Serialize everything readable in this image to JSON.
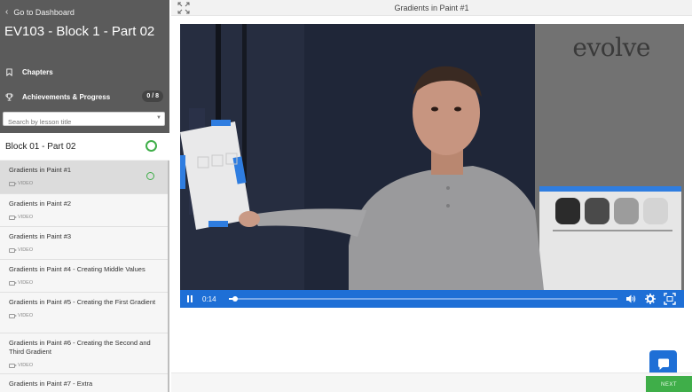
{
  "sidebar": {
    "back_label": "Go to Dashboard",
    "course_title": "EV103 - Block 1 - Part 02",
    "chapters_label": "Chapters",
    "achievements_label": "Achievements & Progress",
    "achievements_count": "0 / 8",
    "search_placeholder": "Search by lesson title",
    "block_title": "Block 01 - Part 02",
    "lessons": [
      {
        "title": "Gradients in Paint #1",
        "type": "VIDEO"
      },
      {
        "title": "Gradients in Paint #2",
        "type": "VIDEO"
      },
      {
        "title": "Gradients in Paint #3",
        "type": "VIDEO"
      },
      {
        "title": "Gradients in Paint #4 - Creating Middle Values",
        "type": "VIDEO"
      },
      {
        "title": "Gradients in Paint #5 - Creating the First Gradient",
        "type": "VIDEO"
      },
      {
        "title": "Gradients in Paint #6 - Creating the Second and Third Gradient",
        "type": "VIDEO"
      },
      {
        "title": "Gradients in Paint #7 - Extra",
        "type": ""
      }
    ]
  },
  "main": {
    "lesson_heading": "Gradients in Paint #1",
    "video": {
      "logo_text": "evolve",
      "current_time": "0:14",
      "progress_fraction": 0.015
    },
    "next_label": "NEXT"
  },
  "colors": {
    "accent_blue": "#1e6fd6",
    "success_green": "#3fae49",
    "sidebar_dark": "#5b5b5b"
  },
  "icons": {
    "back": "chevron-left-icon",
    "chapters": "bookmark-icon",
    "achievements": "trophy-icon",
    "expand": "expand-icon",
    "pause": "pause-icon",
    "volume": "volume-icon",
    "settings": "gear-icon",
    "fullscreen": "fullscreen-icon",
    "chat": "chat-icon"
  }
}
